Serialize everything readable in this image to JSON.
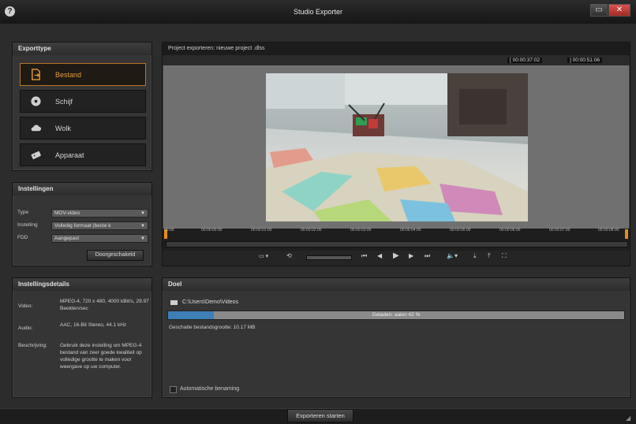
{
  "window": {
    "title": "Studio Exporter",
    "help_glyph": "?",
    "minimize_glyph": "▭",
    "close_glyph": "✕"
  },
  "export_type": {
    "heading": "Exporttype",
    "items": [
      {
        "label": "Bestand",
        "icon": "file-export-icon",
        "active": true
      },
      {
        "label": "Schijf",
        "icon": "disc-icon",
        "active": false
      },
      {
        "label": "Wolk",
        "icon": "cloud-icon",
        "active": false
      },
      {
        "label": "Apparaat",
        "icon": "device-icon",
        "active": false
      }
    ]
  },
  "settings": {
    "heading": "Instellingen",
    "type_label": "Type",
    "type_value": "MOV-video",
    "preset_label": "Instelling",
    "preset_value": "Volledig formaat (beste k",
    "fdd_label": "FDD",
    "fdd_value": "Aangepast",
    "customize_label": "Doorgeschakeld"
  },
  "details": {
    "heading": "Instellingsdetails",
    "video_label": "Video:",
    "video_value": "MPEG-4, 720 x 480, 4000 kBit/s, 29.97 Beelden/sec",
    "audio_label": "Audio:",
    "audio_value": "AAC, 16-Bit Stereo, 44.1 kHz",
    "description_label": "Beschrijving:",
    "description_value": "Gebruik deze instelling om MPEG-4 bestand van zeer goede kwaliteit op volledige grootte te maken voor weergave op uw computer."
  },
  "preview": {
    "project_title": "Project exporteren: nieuwe project .dlss",
    "timecode_in": "[ 00:00:37:02",
    "timecode_out": "] 00:00:51:06",
    "timeline_ticks": [
      "00:00",
      "00:00:00:00",
      "00:00:01:00",
      "00:00:02:00",
      "00:00:03:00",
      "00:00:04:00",
      "00:00:05:00",
      "00:00:06:00",
      "00:00:07:00",
      "00:00:08:00",
      "00:00:09:"
    ]
  },
  "destination": {
    "heading": "Doel",
    "path": "C:\\Users\\Demo\\Videos",
    "progress_text": "Geladen: aaien 42 %",
    "progress": 0.1,
    "file_size": "Geschatte bestandsgrootte: 10.17 MB",
    "auto_name_label": "Automatische benaming"
  },
  "footer": {
    "start_label": "Exporteren starten"
  }
}
